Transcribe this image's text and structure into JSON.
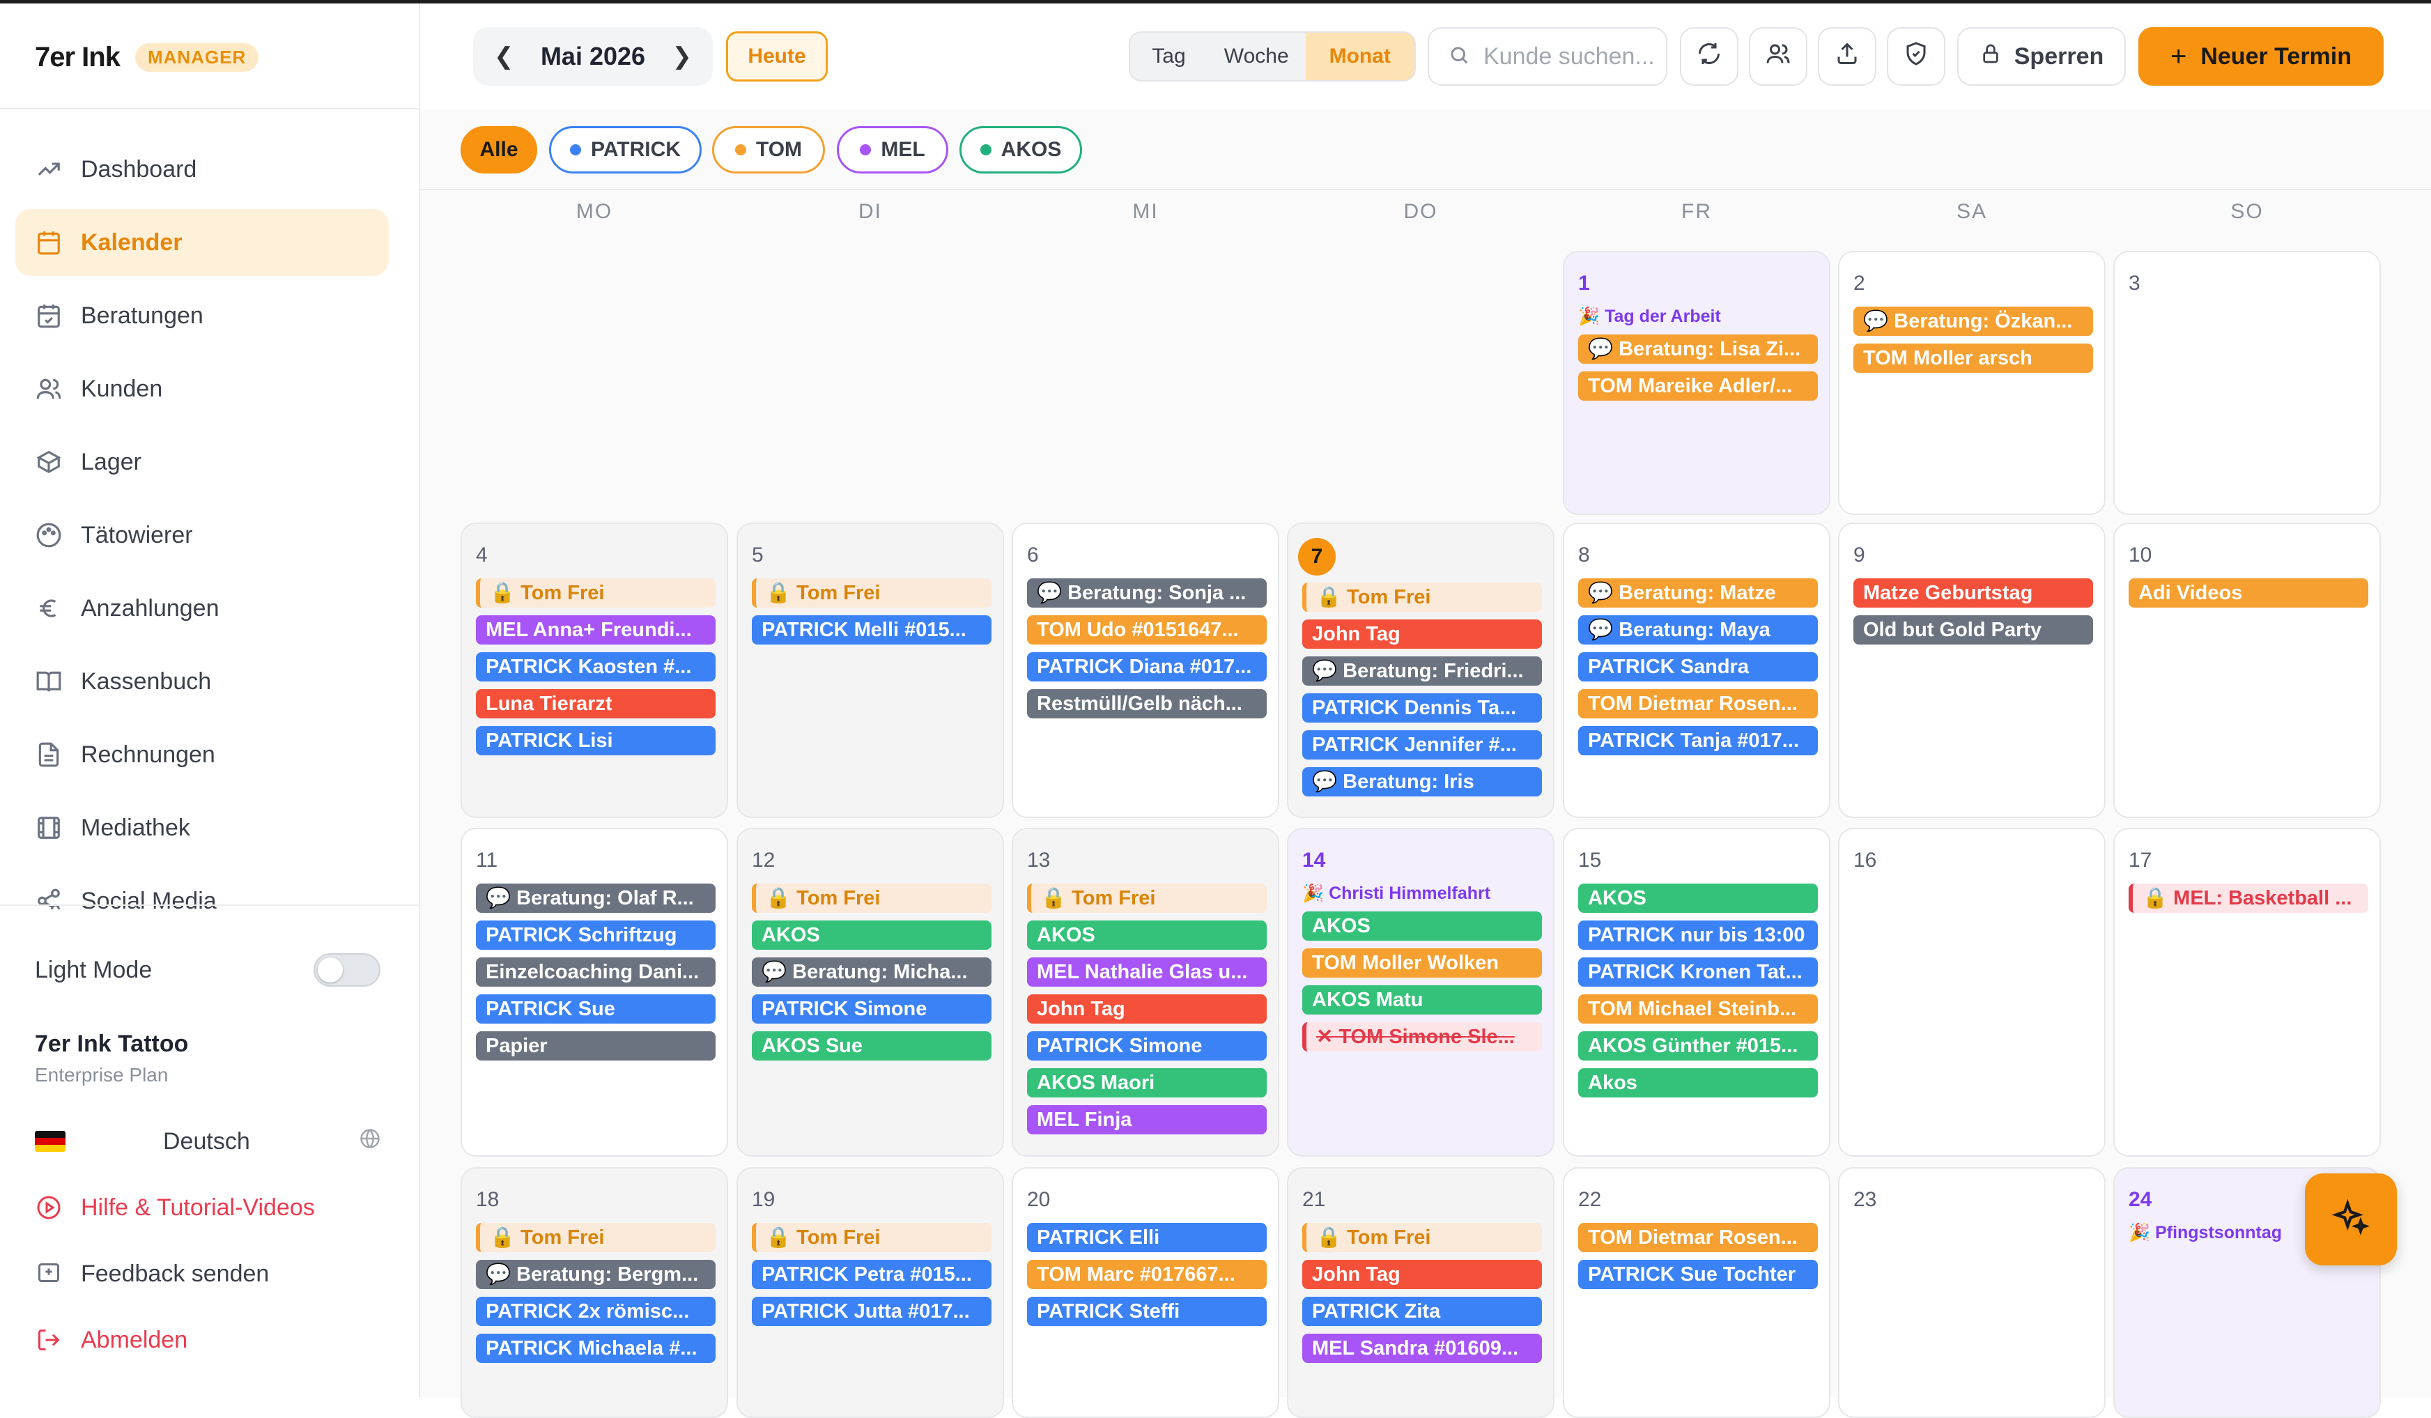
{
  "app": {
    "brand": "7er Ink",
    "badge": "MANAGER"
  },
  "sidebar": {
    "items": [
      {
        "label": "Dashboard",
        "icon": "trend-up-icon"
      },
      {
        "label": "Kalender",
        "icon": "calendar-icon",
        "active": true
      },
      {
        "label": "Beratungen",
        "icon": "calendar-check-icon"
      },
      {
        "label": "Kunden",
        "icon": "users-icon"
      },
      {
        "label": "Lager",
        "icon": "box-icon"
      },
      {
        "label": "Tätowierer",
        "icon": "palette-icon"
      },
      {
        "label": "Anzahlungen",
        "icon": "euro-icon"
      },
      {
        "label": "Kassenbuch",
        "icon": "book-icon"
      },
      {
        "label": "Rechnungen",
        "icon": "document-icon"
      },
      {
        "label": "Mediathek",
        "icon": "film-icon"
      },
      {
        "label": "Social Media",
        "icon": "share-icon"
      }
    ],
    "light_mode_label": "Light Mode",
    "org_name": "7er Ink Tattoo",
    "org_plan": "Enterprise Plan",
    "language": "Deutsch",
    "help_label": "Hilfe & Tutorial-Videos",
    "feedback_label": "Feedback senden",
    "logout_label": "Abmelden"
  },
  "toolbar": {
    "month_label": "Mai 2026",
    "today_label": "Heute",
    "views": [
      "Tag",
      "Woche",
      "Monat"
    ],
    "selected_view": "Monat",
    "search_placeholder": "Kunde suchen...",
    "lock_label": "Sperren",
    "new_label": "Neuer Termin"
  },
  "filters": [
    {
      "label": "Alle",
      "selected": true
    },
    {
      "label": "PATRICK",
      "color": "#3b82f6"
    },
    {
      "label": "TOM",
      "color": "#f5a030"
    },
    {
      "label": "MEL",
      "color": "#a855f7"
    },
    {
      "label": "AKOS",
      "color": "#22b07d"
    }
  ],
  "weekdays": [
    "MO",
    "DI",
    "MI",
    "DO",
    "FR",
    "SA",
    "SO"
  ],
  "colors": {
    "accent": "#f7930f",
    "patrick": "#3b82f6",
    "tom": "#f5a030",
    "mel": "#a855f7",
    "akos": "#34c27a",
    "red": "#f5503a",
    "gray": "#6b7280",
    "holiday": "#7c3aed"
  },
  "weeks": [
    [
      null,
      null,
      null,
      null,
      {
        "day": "1",
        "holiday": "🎉 Tag der Arbeit",
        "events": [
          {
            "text": "💬 Beratung: Lisa Zi...",
            "type": "orange"
          },
          {
            "text": "TOM Mareike Adler/...",
            "type": "orange"
          }
        ]
      },
      {
        "day": "2",
        "events": [
          {
            "text": "💬 Beratung: Özkan...",
            "type": "orange"
          },
          {
            "text": "TOM Moller arsch",
            "type": "orange"
          }
        ]
      },
      {
        "day": "3",
        "events": []
      }
    ],
    [
      {
        "day": "4",
        "past": true,
        "events": [
          {
            "text": "🔒 Tom Frei",
            "type": "frei"
          },
          {
            "text": "MEL Anna+ Freundi...",
            "type": "purple"
          },
          {
            "text": "PATRICK Kaosten #...",
            "type": "blue"
          },
          {
            "text": "Luna Tierarzt",
            "type": "red"
          },
          {
            "text": "PATRICK Lisi",
            "type": "blue"
          }
        ]
      },
      {
        "day": "5",
        "past": true,
        "events": [
          {
            "text": "🔒 Tom Frei",
            "type": "frei"
          },
          {
            "text": "PATRICK Melli #015...",
            "type": "blue"
          }
        ]
      },
      {
        "day": "6",
        "events": [
          {
            "text": "💬 Beratung: Sonja ...",
            "type": "gray"
          },
          {
            "text": "TOM Udo #0151647...",
            "type": "orange"
          },
          {
            "text": "PATRICK Diana #017...",
            "type": "blue"
          },
          {
            "text": "Restmüll/Gelb näch...",
            "type": "gray"
          }
        ]
      },
      {
        "day": "7",
        "today": true,
        "past": true,
        "events": [
          {
            "text": "🔒 Tom Frei",
            "type": "frei"
          },
          {
            "text": "John Tag",
            "type": "red"
          },
          {
            "text": "💬 Beratung: Friedri...",
            "type": "gray"
          },
          {
            "text": "PATRICK Dennis Ta...",
            "type": "blue"
          },
          {
            "text": "PATRICK Jennifer #...",
            "type": "blue"
          },
          {
            "text": "💬 Beratung: Iris",
            "type": "blue"
          }
        ]
      },
      {
        "day": "8",
        "events": [
          {
            "text": "💬 Beratung: Matze",
            "type": "orange"
          },
          {
            "text": "💬 Beratung: Maya",
            "type": "blue"
          },
          {
            "text": "PATRICK Sandra",
            "type": "blue"
          },
          {
            "text": "TOM Dietmar Rosen...",
            "type": "orange"
          },
          {
            "text": "PATRICK Tanja #017...",
            "type": "blue"
          }
        ]
      },
      {
        "day": "9",
        "events": [
          {
            "text": "Matze Geburtstag",
            "type": "red"
          },
          {
            "text": "Old but Gold Party",
            "type": "gray"
          }
        ]
      },
      {
        "day": "10",
        "events": [
          {
            "text": "Adi Videos",
            "type": "orange"
          }
        ]
      }
    ],
    [
      {
        "day": "11",
        "events": [
          {
            "text": "💬 Beratung: Olaf R...",
            "type": "gray"
          },
          {
            "text": "PATRICK Schriftzug",
            "type": "blue"
          },
          {
            "text": "Einzelcoaching Dani...",
            "type": "gray"
          },
          {
            "text": "PATRICK Sue",
            "type": "blue"
          },
          {
            "text": "Papier",
            "type": "gray"
          }
        ]
      },
      {
        "day": "12",
        "past": true,
        "events": [
          {
            "text": "🔒 Tom Frei",
            "type": "frei"
          },
          {
            "text": "AKOS",
            "type": "green"
          },
          {
            "text": "💬 Beratung: Micha...",
            "type": "gray"
          },
          {
            "text": "PATRICK Simone",
            "type": "blue"
          },
          {
            "text": "AKOS Sue",
            "type": "green"
          }
        ]
      },
      {
        "day": "13",
        "past": true,
        "events": [
          {
            "text": "🔒 Tom Frei",
            "type": "frei"
          },
          {
            "text": "AKOS",
            "type": "green"
          },
          {
            "text": "MEL Nathalie Glas u...",
            "type": "purple"
          },
          {
            "text": "John Tag",
            "type": "red"
          },
          {
            "text": "PATRICK Simone",
            "type": "blue"
          },
          {
            "text": "AKOS Maori",
            "type": "green"
          },
          {
            "text": "MEL Finja",
            "type": "purple"
          }
        ]
      },
      {
        "day": "14",
        "holiday": "🎉 Christi Himmelfahrt",
        "events": [
          {
            "text": "AKOS",
            "type": "green"
          },
          {
            "text": "TOM Moller Wolken",
            "type": "orange"
          },
          {
            "text": "AKOS Matu",
            "type": "green"
          },
          {
            "text": "✕ TOM Simone Sle...",
            "type": "cancel"
          }
        ]
      },
      {
        "day": "15",
        "events": [
          {
            "text": "AKOS",
            "type": "green"
          },
          {
            "text": "PATRICK nur bis 13:00",
            "type": "blue"
          },
          {
            "text": "PATRICK Kronen Tat...",
            "type": "blue"
          },
          {
            "text": "TOM Michael Steinb...",
            "type": "orange"
          },
          {
            "text": "AKOS Günther #015...",
            "type": "green"
          },
          {
            "text": "Akos",
            "type": "green"
          }
        ]
      },
      {
        "day": "16",
        "events": []
      },
      {
        "day": "17",
        "events": [
          {
            "text": "🔒 MEL: Basketball ...",
            "type": "pinkred"
          }
        ]
      }
    ],
    [
      {
        "day": "18",
        "past": true,
        "events": [
          {
            "text": "🔒 Tom Frei",
            "type": "frei"
          },
          {
            "text": "💬 Beratung: Bergm...",
            "type": "gray"
          },
          {
            "text": "PATRICK 2x römisc...",
            "type": "blue"
          },
          {
            "text": "PATRICK Michaela #...",
            "type": "blue"
          }
        ]
      },
      {
        "day": "19",
        "past": true,
        "events": [
          {
            "text": "🔒 Tom Frei",
            "type": "frei"
          },
          {
            "text": "PATRICK Petra #015...",
            "type": "blue"
          },
          {
            "text": "PATRICK Jutta #017...",
            "type": "blue"
          }
        ]
      },
      {
        "day": "20",
        "events": [
          {
            "text": "PATRICK Elli",
            "type": "blue"
          },
          {
            "text": "TOM Marc #017667...",
            "type": "orange"
          },
          {
            "text": "PATRICK Steffi",
            "type": "blue"
          }
        ]
      },
      {
        "day": "21",
        "past": true,
        "events": [
          {
            "text": "🔒 Tom Frei",
            "type": "frei"
          },
          {
            "text": "John Tag",
            "type": "red"
          },
          {
            "text": "PATRICK Zita",
            "type": "blue"
          },
          {
            "text": "MEL Sandra #01609...",
            "type": "purple"
          }
        ]
      },
      {
        "day": "22",
        "events": [
          {
            "text": "TOM Dietmar Rosen...",
            "type": "orange"
          },
          {
            "text": "PATRICK Sue Tochter",
            "type": "blue"
          }
        ]
      },
      {
        "day": "23",
        "events": []
      },
      {
        "day": "24",
        "holiday": "🎉 Pfingstsonntag",
        "events": []
      }
    ]
  ]
}
